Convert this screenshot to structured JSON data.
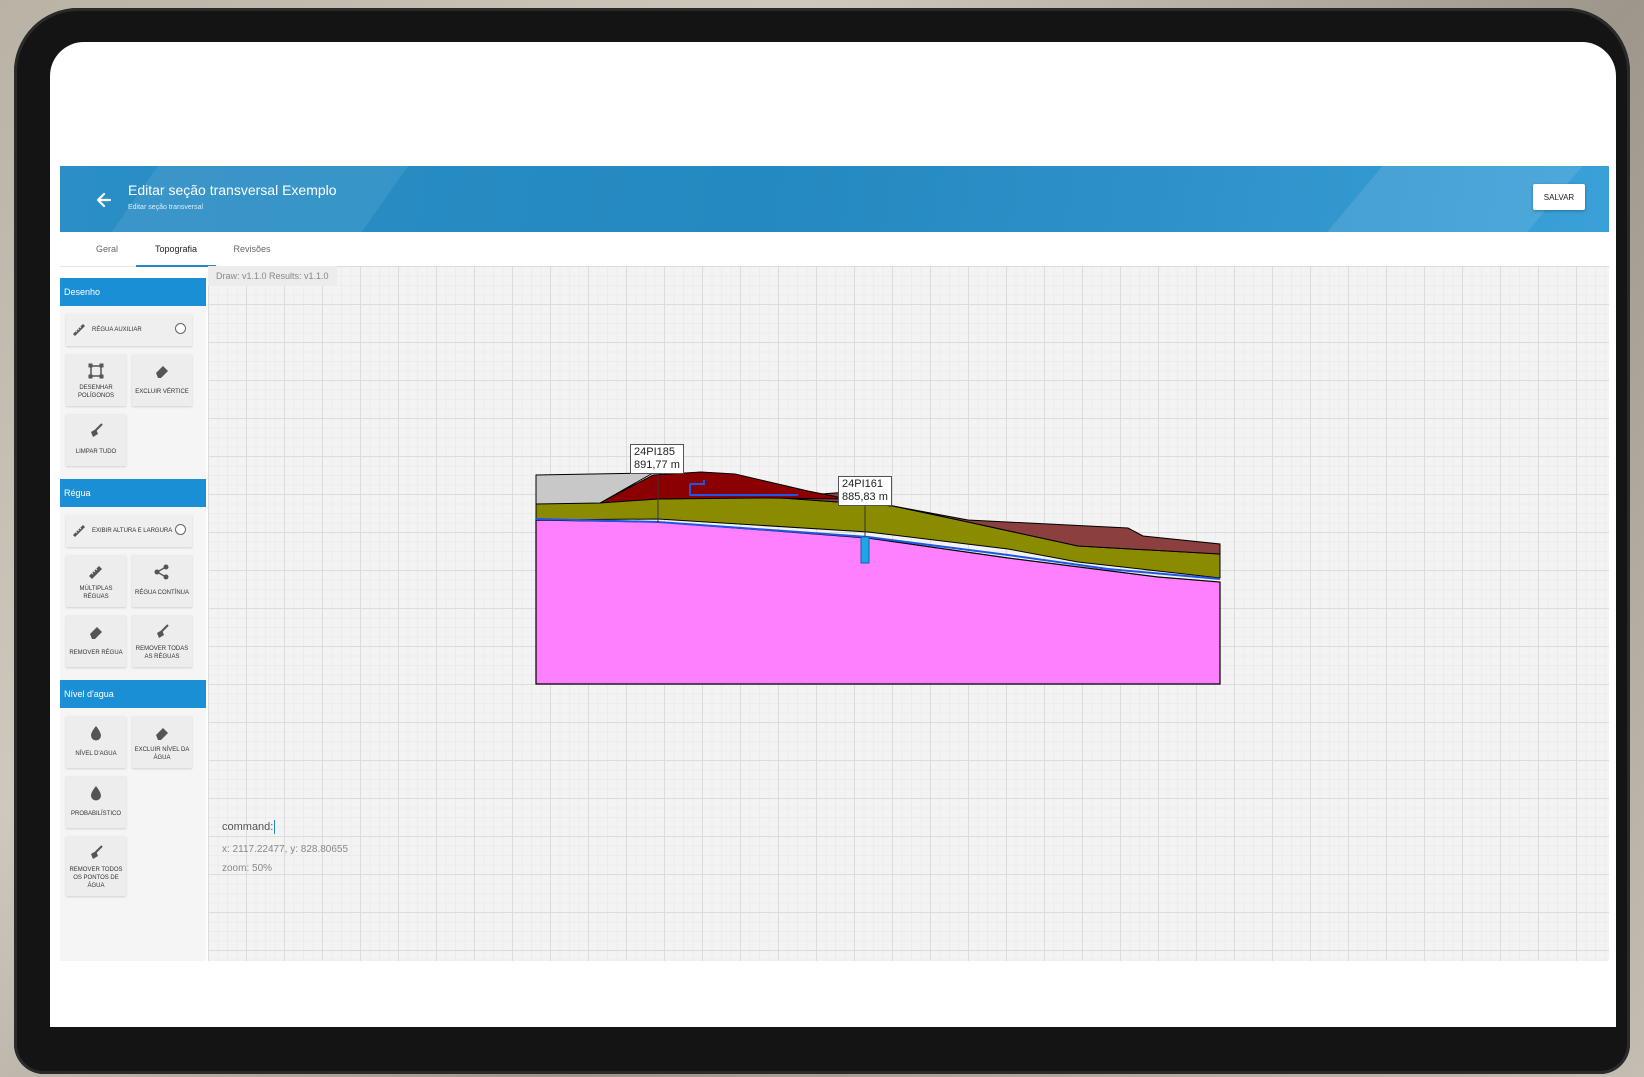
{
  "header": {
    "title": "Editar seção transversal Exemplo",
    "subtitle": "Editar seção transversal",
    "save_label": "SALVAR"
  },
  "tabs": [
    {
      "label": "Geral"
    },
    {
      "label": "Topografia"
    },
    {
      "label": "Revisões"
    }
  ],
  "active_tab": "Topografia",
  "sidebar": {
    "desenho": {
      "title": "Desenho",
      "regua_auxiliar": "RÉGUA AUXILIAR",
      "desenhar_poligonos": "DESENHAR POLÍGONOS",
      "excluir_vertice": "EXCLUIR VÉRTICE",
      "limpar_tudo": "LIMPAR TUDO"
    },
    "regua": {
      "title": "Régua",
      "exibir_altura": "EXIBIR ALTURA E LARGURA",
      "multiplas_reguas": "MÚLTIPLAS RÉGUAS",
      "regua_continua": "RÉGUA CONTÍNUA",
      "remover_regua": "REMOVER RÉGUA",
      "remover_todas": "REMOVER TODAS AS RÉGUAS"
    },
    "nivel": {
      "title": "Nível d'agua",
      "nivel_dagua": "NÍVEL D'AGUA",
      "excluir_nivel": "EXCLUIR NÍVEL DA ÁGUA",
      "probabilistico": "PROBABILÍSTICO",
      "remover_pontos": "REMOVER TODOS OS PONTOS DE ÁGUA"
    }
  },
  "canvas": {
    "version": "Draw: v1.1.0 Results: v1.1.0",
    "command_label": "command:",
    "coords": "x: 2117.22477, y: 828.80655",
    "zoom": "zoom: 50%"
  },
  "wells": [
    {
      "id": "24PI185",
      "elevation": "891,77 m"
    },
    {
      "id": "24PI161",
      "elevation": "885,83 m"
    }
  ],
  "layer_colors": {
    "foundation": "#ff80ff",
    "clay_layer": "#8b8b00",
    "top_fill": "#8b3f3f",
    "crest": "#8b0000",
    "embankment": "#c8c8c8",
    "water_table": "#1f56e6",
    "piezometer": "#1da7e6"
  }
}
